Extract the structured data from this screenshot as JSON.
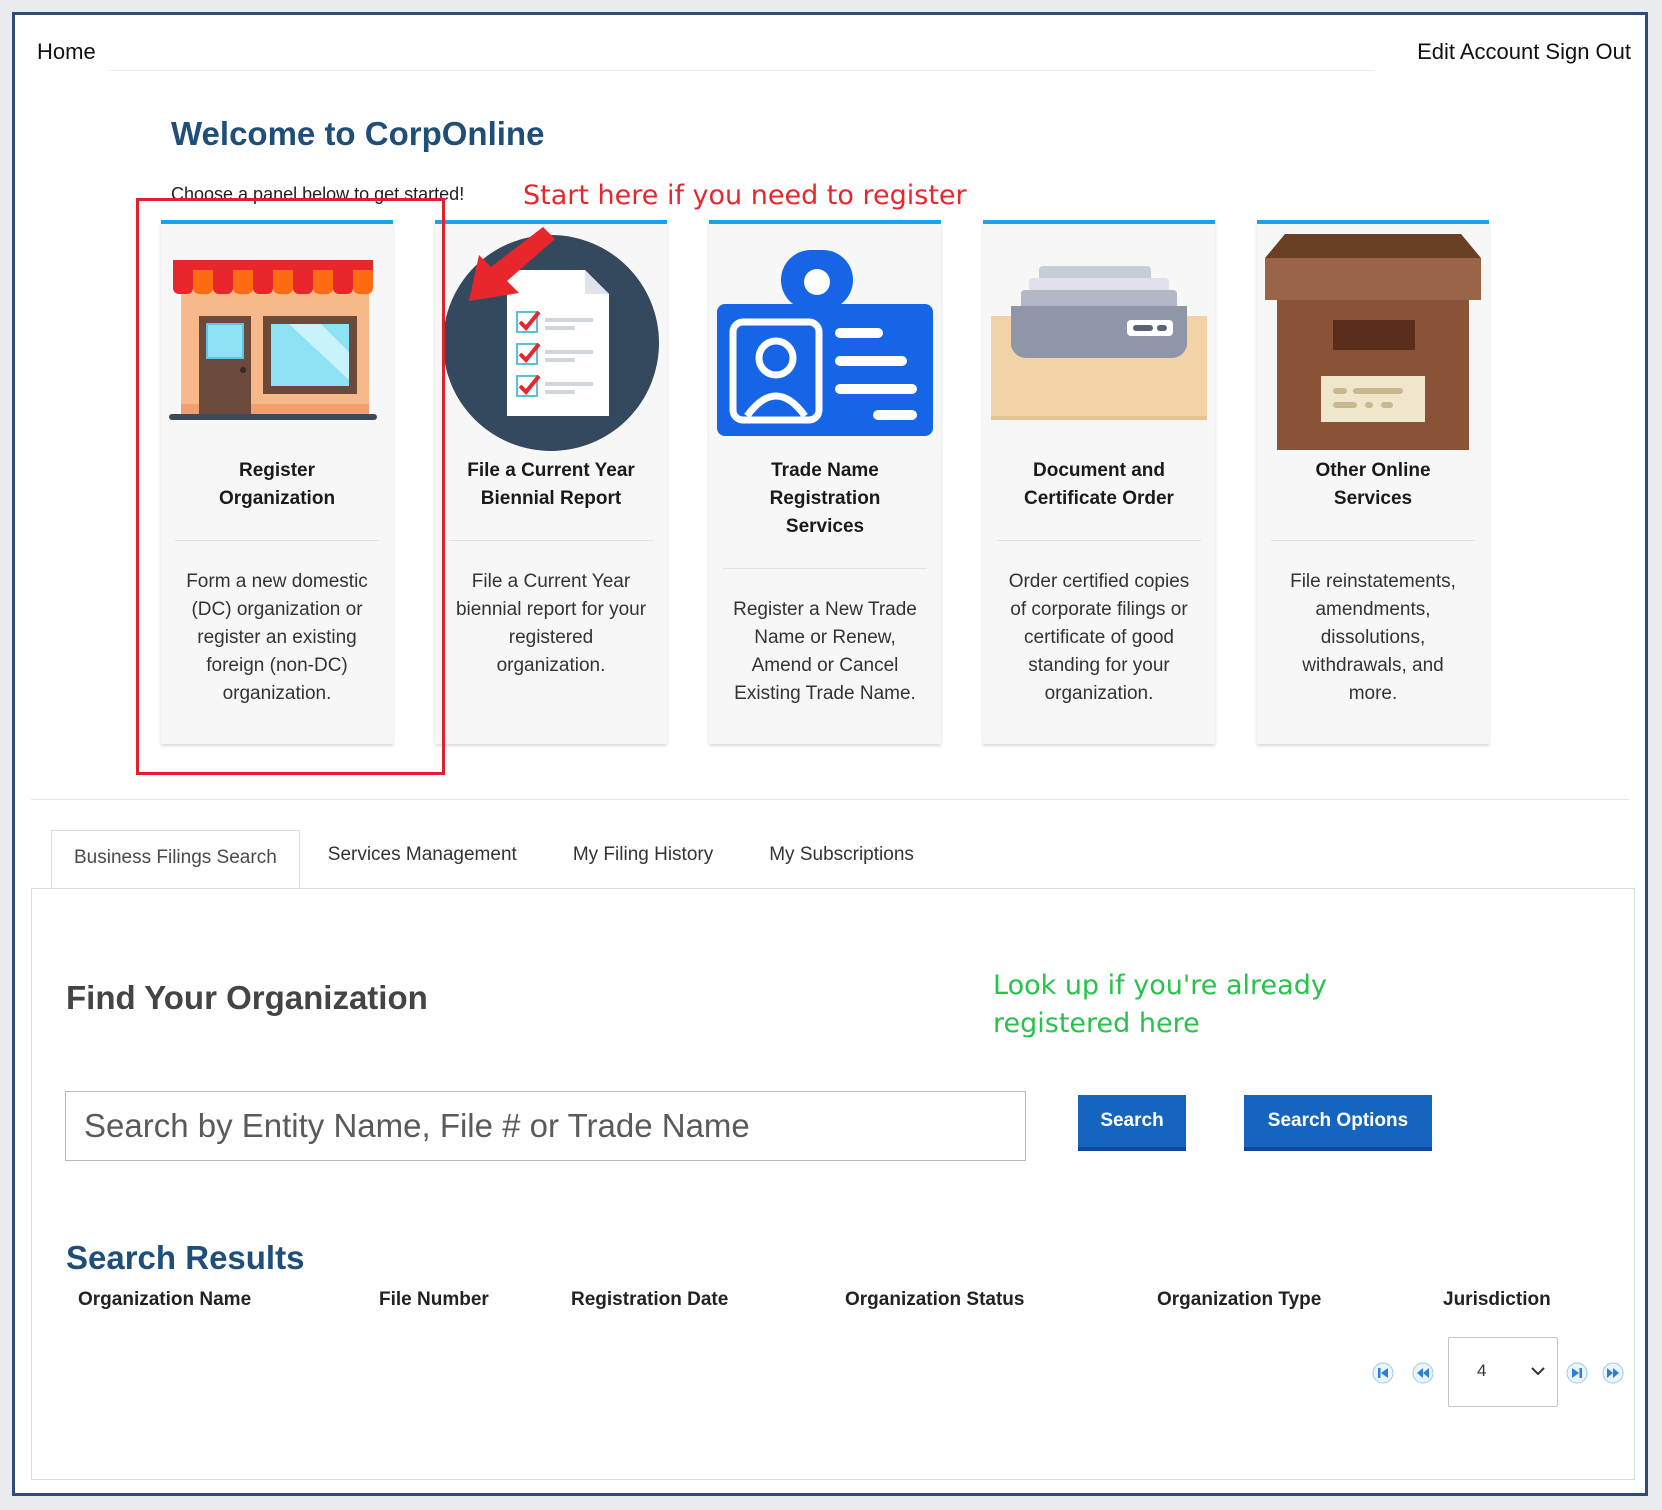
{
  "nav": {
    "home": "Home",
    "edit_account": "Edit Account",
    "sign_out": "Sign Out"
  },
  "welcome": {
    "title": "Welcome to CorpOnline",
    "subtitle": "Choose a panel below to get started!"
  },
  "annotations": {
    "register": "Start here if you need to register",
    "lookup_line1": "Look up if you're already",
    "lookup_line2": "registered here"
  },
  "panels": [
    {
      "icon": "storefront-icon",
      "title_lines": [
        "Register",
        "Organization"
      ],
      "desc_lines": [
        "Form a new domestic",
        "(DC) organization or",
        "register an existing",
        "foreign (non-DC)",
        "organization."
      ]
    },
    {
      "icon": "checklist-icon",
      "title_lines": [
        "File a Current Year",
        "Biennial Report"
      ],
      "desc_lines": [
        "File a Current Year",
        "biennial report for your",
        "registered",
        "organization."
      ]
    },
    {
      "icon": "id-badge-icon",
      "title_lines": [
        "Trade Name",
        "Registration",
        "Services"
      ],
      "desc_lines": [
        "Register a New Trade",
        "Name or Renew,",
        "Amend or Cancel",
        "Existing Trade Name."
      ]
    },
    {
      "icon": "file-drawer-icon",
      "title_lines": [
        "Document and",
        "Certificate Order"
      ],
      "desc_lines": [
        "Order certified copies",
        "of corporate filings or",
        "certificate of good",
        "standing for your",
        "organization."
      ]
    },
    {
      "icon": "archive-box-icon",
      "title_lines": [
        "Other Online",
        "Services"
      ],
      "desc_lines": [
        "File reinstatements,",
        "amendments,",
        "dissolutions,",
        "withdrawals, and",
        "more."
      ]
    }
  ],
  "tabs": [
    "Business Filings Search",
    "Services Management",
    "My Filing History",
    "My Subscriptions"
  ],
  "search": {
    "heading": "Find Your Organization",
    "placeholder": "Search by Entity Name, File # or Trade Name",
    "search_button": "Search",
    "options_button": "Search Options"
  },
  "results": {
    "heading": "Search Results",
    "columns": [
      "Organization Name",
      "File Number",
      "Registration Date",
      "Organization Status",
      "Organization Type",
      "Jurisdiction"
    ]
  },
  "pager": {
    "page_size": "4"
  },
  "colors": {
    "accent": "#1565c0",
    "heading": "#1f4e79",
    "annotation_red": "#e8262b",
    "annotation_green": "#27c24c",
    "panel_top": "#1aa3e8"
  }
}
